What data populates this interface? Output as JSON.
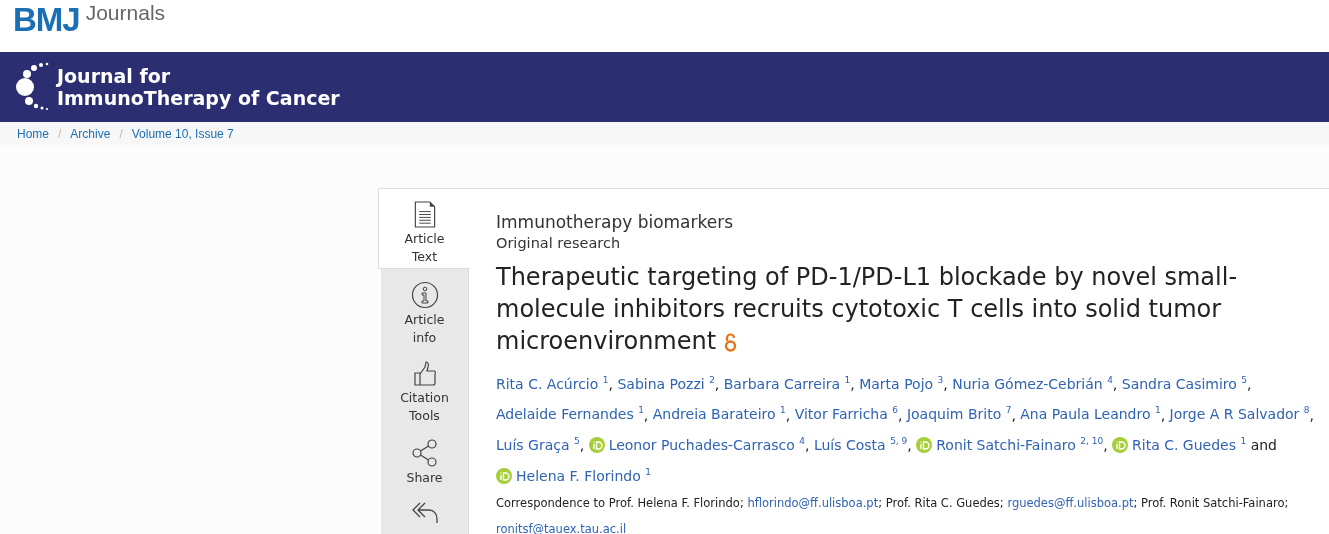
{
  "header": {
    "logo_mark": "BMJ",
    "logo_text": "Journals"
  },
  "banner": {
    "journal_title": [
      "Journal for",
      "ImmunoTherapy of Cancer"
    ]
  },
  "breadcrumb": [
    {
      "label": "Home",
      "separator": "/"
    },
    {
      "label": "Archive",
      "separator": "/"
    },
    {
      "label": "Volume 10, Issue 7"
    }
  ],
  "sidebar": {
    "items": [
      {
        "kind": "article",
        "label": [
          "Article",
          "Text"
        ],
        "selected": true
      },
      {
        "kind": "info",
        "label": [
          "Article",
          "info"
        ],
        "selected": false
      },
      {
        "kind": "citation",
        "label": [
          "Citation",
          "Tools"
        ],
        "selected": false
      },
      {
        "kind": "share",
        "label": [
          "Share"
        ],
        "selected": false
      },
      {
        "kind": "reply",
        "selected": false
      }
    ]
  },
  "article": {
    "section": "Immunotherapy biomarkers",
    "type": "Original research",
    "title": "Therapeutic targeting of PD-1/PD-L1 blockade by novel small-molecule inhibitors recruits cytotoxic T cells into solid tumor microenvironment",
    "open_access": true,
    "authors": [
      {
        "name": "Rita C. Acúrcio",
        "affiliations": "1",
        "orcid": false,
        "separator": ", "
      },
      {
        "name": "Sabina Pozzi",
        "affiliations": "2",
        "orcid": false,
        "separator": ", "
      },
      {
        "name": "Barbara Carreira",
        "affiliations": "1",
        "orcid": false,
        "separator": ", "
      },
      {
        "name": "Marta Pojo",
        "affiliations": "3",
        "orcid": false,
        "separator": ", "
      },
      {
        "name": "Nuria Gómez-Cebrián",
        "affiliations": "4",
        "orcid": false,
        "separator": ", "
      },
      {
        "name": "Sandra Casimiro",
        "affiliations": "5",
        "orcid": false,
        "separator": ", "
      },
      {
        "name": "Adelaide Fernandes",
        "affiliations": "1",
        "orcid": false,
        "separator": ", "
      },
      {
        "name": "Andreia Barateiro",
        "affiliations": "1",
        "orcid": false,
        "separator": ", "
      },
      {
        "name": "Vitor Farricha",
        "affiliations": "6",
        "orcid": false,
        "separator": ", "
      },
      {
        "name": "Joaquim Brito",
        "affiliations": "7",
        "orcid": false,
        "separator": ", "
      },
      {
        "name": "Ana Paula Leandro",
        "affiliations": "1",
        "orcid": false,
        "separator": ", "
      },
      {
        "name": "Jorge A R Salvador",
        "affiliations": "8",
        "orcid": false,
        "separator": ", "
      },
      {
        "name": "Luís Graça",
        "affiliations": "5",
        "orcid": false,
        "separator": ", "
      },
      {
        "name": "Leonor Puchades-Carrasco",
        "affiliations": "4",
        "orcid": true,
        "separator": ", "
      },
      {
        "name": "Luís Costa",
        "affiliations": "5, 9",
        "orcid": false,
        "separator": ", "
      },
      {
        "name": "Ronit Satchi-Fainaro",
        "affiliations": "2, 10",
        "orcid": true,
        "separator": ", "
      },
      {
        "name": "Rita C. Guedes",
        "affiliations": "1",
        "orcid": true,
        "separator": " and "
      },
      {
        "name": "Helena F. Florindo",
        "affiliations": "1",
        "orcid": true
      }
    ],
    "correspondence": [
      {
        "kind": "text",
        "text": "Correspondence to Prof. Helena F. Florindo; "
      },
      {
        "kind": "email",
        "text": "hflorindo@ff.ulisboa.pt"
      },
      {
        "kind": "text",
        "text": "; Prof. Rita C. Guedes; "
      },
      {
        "kind": "email",
        "text": "rguedes@ff.ulisboa.pt"
      },
      {
        "kind": "text",
        "text": "; Prof. Ronit Satchi-Fainaro; "
      },
      {
        "kind": "email",
        "text": "ronitsf@tauex.tau.ac.il"
      }
    ]
  }
}
